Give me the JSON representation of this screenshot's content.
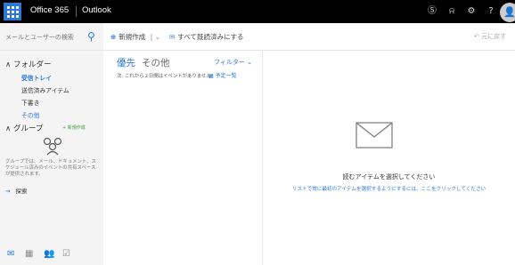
{
  "topbar": {
    "brand": "Office 365",
    "app": "Outlook",
    "icons": [
      "skype-icon",
      "bell-icon",
      "gear-icon",
      "help-icon"
    ],
    "avatar_icon": "person-icon"
  },
  "commands": {
    "search_placeholder": "メールとユーザーの検索",
    "new_label": "新規作成",
    "new_icon": "plus-icon",
    "new_dropdown_icon": "chevron-down-icon",
    "mark_all_read_label": "すべて既読済みにする",
    "mark_all_read_icon": "envelope-open-icon",
    "undo_label": "元に戻す",
    "undo_icon": "undo-icon"
  },
  "sidebar": {
    "folders_header": "フォルダー",
    "folders": [
      {
        "label": "受信トレイ",
        "selected": true
      },
      {
        "label": "送信済みアイテム",
        "selected": false
      },
      {
        "label": "下書き",
        "selected": false
      },
      {
        "label": "その他",
        "selected": false
      }
    ],
    "groups_header": "グループ",
    "groups_new": "+ 新規作成",
    "groups_description": "グループでは、メール、ドキュメント、スケジュール済みのイベントの共有スペースが提供されます。",
    "discover_label": "探索",
    "bottom_nav": [
      "mail-icon",
      "calendar-icon",
      "people-icon",
      "tasks-icon"
    ]
  },
  "message_list": {
    "tab_focused": "優先",
    "tab_other": "その他",
    "filter_label": "フィルター",
    "upcoming_text": "次: これから２日間はイベントがありません",
    "agenda_label": "予定一覧"
  },
  "reading_pane": {
    "title": "読むアイテムを選択してください",
    "link": "リストで常に最初のアイテムを選択するようにするには、ここをクリックしてください"
  },
  "colors": {
    "accent": "#2b78d8",
    "topbar": "#000000",
    "sidebar": "#f4f4f4"
  }
}
